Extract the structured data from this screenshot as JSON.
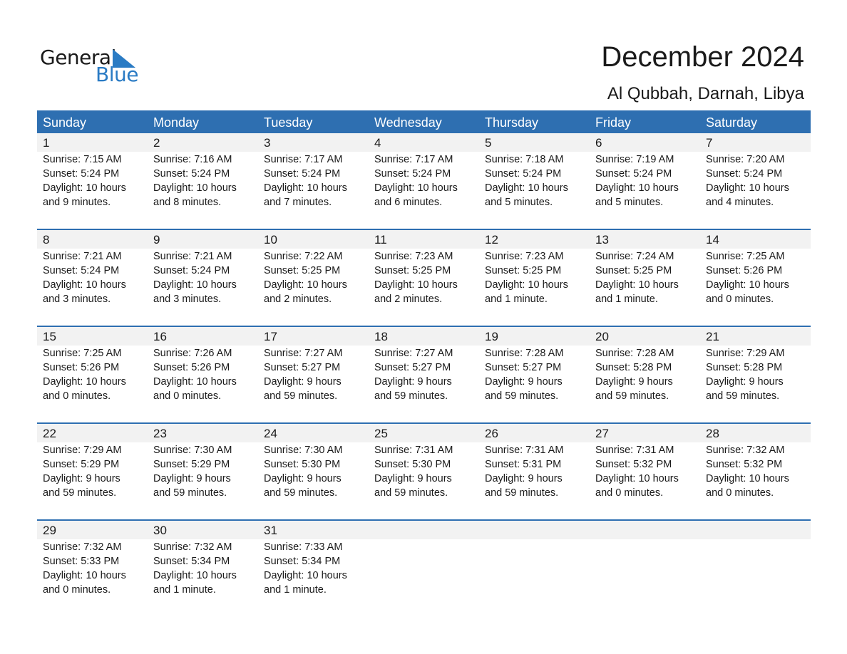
{
  "logo": {
    "general": "General",
    "blue": "Blue"
  },
  "header": {
    "title": "December 2024",
    "location": "Al Qubbah, Darnah, Libya"
  },
  "weekdays": [
    "Sunday",
    "Monday",
    "Tuesday",
    "Wednesday",
    "Thursday",
    "Friday",
    "Saturday"
  ],
  "weeks": [
    [
      {
        "day": "1",
        "sunrise": "Sunrise: 7:15 AM",
        "sunset": "Sunset: 5:24 PM",
        "daylight1": "Daylight: 10 hours",
        "daylight2": "and 9 minutes."
      },
      {
        "day": "2",
        "sunrise": "Sunrise: 7:16 AM",
        "sunset": "Sunset: 5:24 PM",
        "daylight1": "Daylight: 10 hours",
        "daylight2": "and 8 minutes."
      },
      {
        "day": "3",
        "sunrise": "Sunrise: 7:17 AM",
        "sunset": "Sunset: 5:24 PM",
        "daylight1": "Daylight: 10 hours",
        "daylight2": "and 7 minutes."
      },
      {
        "day": "4",
        "sunrise": "Sunrise: 7:17 AM",
        "sunset": "Sunset: 5:24 PM",
        "daylight1": "Daylight: 10 hours",
        "daylight2": "and 6 minutes."
      },
      {
        "day": "5",
        "sunrise": "Sunrise: 7:18 AM",
        "sunset": "Sunset: 5:24 PM",
        "daylight1": "Daylight: 10 hours",
        "daylight2": "and 5 minutes."
      },
      {
        "day": "6",
        "sunrise": "Sunrise: 7:19 AM",
        "sunset": "Sunset: 5:24 PM",
        "daylight1": "Daylight: 10 hours",
        "daylight2": "and 5 minutes."
      },
      {
        "day": "7",
        "sunrise": "Sunrise: 7:20 AM",
        "sunset": "Sunset: 5:24 PM",
        "daylight1": "Daylight: 10 hours",
        "daylight2": "and 4 minutes."
      }
    ],
    [
      {
        "day": "8",
        "sunrise": "Sunrise: 7:21 AM",
        "sunset": "Sunset: 5:24 PM",
        "daylight1": "Daylight: 10 hours",
        "daylight2": "and 3 minutes."
      },
      {
        "day": "9",
        "sunrise": "Sunrise: 7:21 AM",
        "sunset": "Sunset: 5:24 PM",
        "daylight1": "Daylight: 10 hours",
        "daylight2": "and 3 minutes."
      },
      {
        "day": "10",
        "sunrise": "Sunrise: 7:22 AM",
        "sunset": "Sunset: 5:25 PM",
        "daylight1": "Daylight: 10 hours",
        "daylight2": "and 2 minutes."
      },
      {
        "day": "11",
        "sunrise": "Sunrise: 7:23 AM",
        "sunset": "Sunset: 5:25 PM",
        "daylight1": "Daylight: 10 hours",
        "daylight2": "and 2 minutes."
      },
      {
        "day": "12",
        "sunrise": "Sunrise: 7:23 AM",
        "sunset": "Sunset: 5:25 PM",
        "daylight1": "Daylight: 10 hours",
        "daylight2": "and 1 minute."
      },
      {
        "day": "13",
        "sunrise": "Sunrise: 7:24 AM",
        "sunset": "Sunset: 5:25 PM",
        "daylight1": "Daylight: 10 hours",
        "daylight2": "and 1 minute."
      },
      {
        "day": "14",
        "sunrise": "Sunrise: 7:25 AM",
        "sunset": "Sunset: 5:26 PM",
        "daylight1": "Daylight: 10 hours",
        "daylight2": "and 0 minutes."
      }
    ],
    [
      {
        "day": "15",
        "sunrise": "Sunrise: 7:25 AM",
        "sunset": "Sunset: 5:26 PM",
        "daylight1": "Daylight: 10 hours",
        "daylight2": "and 0 minutes."
      },
      {
        "day": "16",
        "sunrise": "Sunrise: 7:26 AM",
        "sunset": "Sunset: 5:26 PM",
        "daylight1": "Daylight: 10 hours",
        "daylight2": "and 0 minutes."
      },
      {
        "day": "17",
        "sunrise": "Sunrise: 7:27 AM",
        "sunset": "Sunset: 5:27 PM",
        "daylight1": "Daylight: 9 hours",
        "daylight2": "and 59 minutes."
      },
      {
        "day": "18",
        "sunrise": "Sunrise: 7:27 AM",
        "sunset": "Sunset: 5:27 PM",
        "daylight1": "Daylight: 9 hours",
        "daylight2": "and 59 minutes."
      },
      {
        "day": "19",
        "sunrise": "Sunrise: 7:28 AM",
        "sunset": "Sunset: 5:27 PM",
        "daylight1": "Daylight: 9 hours",
        "daylight2": "and 59 minutes."
      },
      {
        "day": "20",
        "sunrise": "Sunrise: 7:28 AM",
        "sunset": "Sunset: 5:28 PM",
        "daylight1": "Daylight: 9 hours",
        "daylight2": "and 59 minutes."
      },
      {
        "day": "21",
        "sunrise": "Sunrise: 7:29 AM",
        "sunset": "Sunset: 5:28 PM",
        "daylight1": "Daylight: 9 hours",
        "daylight2": "and 59 minutes."
      }
    ],
    [
      {
        "day": "22",
        "sunrise": "Sunrise: 7:29 AM",
        "sunset": "Sunset: 5:29 PM",
        "daylight1": "Daylight: 9 hours",
        "daylight2": "and 59 minutes."
      },
      {
        "day": "23",
        "sunrise": "Sunrise: 7:30 AM",
        "sunset": "Sunset: 5:29 PM",
        "daylight1": "Daylight: 9 hours",
        "daylight2": "and 59 minutes."
      },
      {
        "day": "24",
        "sunrise": "Sunrise: 7:30 AM",
        "sunset": "Sunset: 5:30 PM",
        "daylight1": "Daylight: 9 hours",
        "daylight2": "and 59 minutes."
      },
      {
        "day": "25",
        "sunrise": "Sunrise: 7:31 AM",
        "sunset": "Sunset: 5:30 PM",
        "daylight1": "Daylight: 9 hours",
        "daylight2": "and 59 minutes."
      },
      {
        "day": "26",
        "sunrise": "Sunrise: 7:31 AM",
        "sunset": "Sunset: 5:31 PM",
        "daylight1": "Daylight: 9 hours",
        "daylight2": "and 59 minutes."
      },
      {
        "day": "27",
        "sunrise": "Sunrise: 7:31 AM",
        "sunset": "Sunset: 5:32 PM",
        "daylight1": "Daylight: 10 hours",
        "daylight2": "and 0 minutes."
      },
      {
        "day": "28",
        "sunrise": "Sunrise: 7:32 AM",
        "sunset": "Sunset: 5:32 PM",
        "daylight1": "Daylight: 10 hours",
        "daylight2": "and 0 minutes."
      }
    ],
    [
      {
        "day": "29",
        "sunrise": "Sunrise: 7:32 AM",
        "sunset": "Sunset: 5:33 PM",
        "daylight1": "Daylight: 10 hours",
        "daylight2": "and 0 minutes."
      },
      {
        "day": "30",
        "sunrise": "Sunrise: 7:32 AM",
        "sunset": "Sunset: 5:34 PM",
        "daylight1": "Daylight: 10 hours",
        "daylight2": "and 1 minute."
      },
      {
        "day": "31",
        "sunrise": "Sunrise: 7:33 AM",
        "sunset": "Sunset: 5:34 PM",
        "daylight1": "Daylight: 10 hours",
        "daylight2": "and 1 minute."
      },
      null,
      null,
      null,
      null
    ]
  ]
}
